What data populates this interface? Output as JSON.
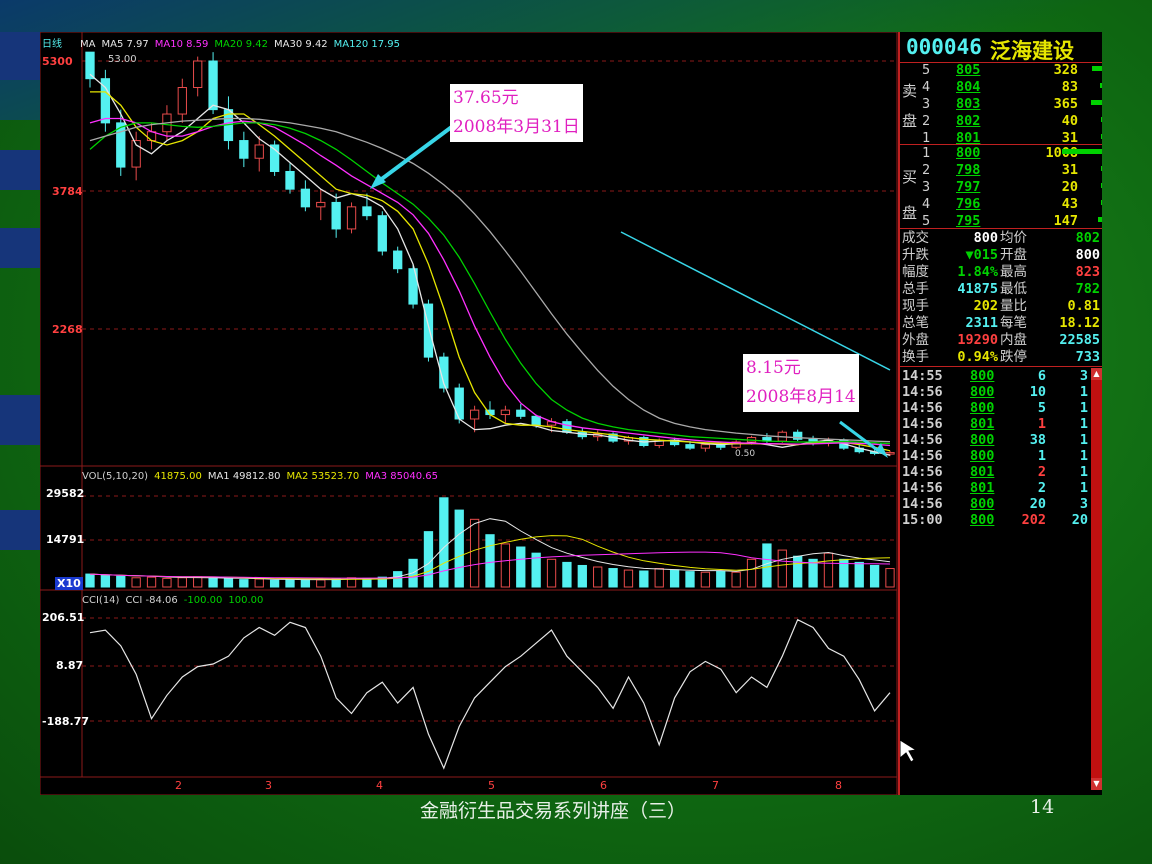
{
  "slide": {
    "title": "金融衍生品交易系列讲座（三）",
    "page_number": "14"
  },
  "colors": {
    "up": "#e84b4b",
    "down": "#54f0f0",
    "ma5": "#e6e6e6",
    "ma10": "#e6e600",
    "ma20": "#ff30ff",
    "ma30": "#00d200",
    "ma120": "#aaaaaa",
    "grid": "#8b1a1a",
    "axis": "#c02020",
    "arrow": "#38d6e8"
  },
  "chart_header": {
    "period": "日线",
    "items": [
      {
        "label": "MA",
        "color": "#e6e6e6"
      },
      {
        "label": "MA5 7.97",
        "color": "#e6e6e6"
      },
      {
        "label": "MA10 8.59",
        "color": "#ff30ff"
      },
      {
        "label": "MA20 9.42",
        "color": "#00d200"
      },
      {
        "label": "MA30 9.42",
        "color": "#e6e6e6"
      },
      {
        "label": "MA120 17.95",
        "color": "#54f0f0"
      }
    ]
  },
  "price_axis": {
    "ticks": [
      "5300",
      "3784",
      "2268"
    ],
    "high_label": "53.00",
    "low_label": "0.50"
  },
  "volume_header": {
    "items": [
      {
        "label": "VOL(5,10,20)",
        "color": "#d0d0d0"
      },
      {
        "label": "41875.00",
        "color": "#e6e600"
      },
      {
        "label": "MA1 49812.80",
        "color": "#e6e6e6"
      },
      {
        "label": "MA2 53523.70",
        "color": "#e6e600"
      },
      {
        "label": "MA3 85040.65",
        "color": "#ff30ff"
      }
    ],
    "ticks": [
      "29582",
      "14791"
    ],
    "unit": "X10"
  },
  "cci_header": {
    "items": [
      {
        "label": "CCI(14)",
        "color": "#d0d0d0"
      },
      {
        "label": "CCI -84.06",
        "color": "#d0d0d0"
      },
      {
        "label": "-100.00",
        "color": "#00d200"
      },
      {
        "label": "100.00",
        "color": "#00d200"
      }
    ],
    "ticks": [
      "206.51",
      "8.87",
      "-188.77"
    ]
  },
  "time_axis": [
    "2",
    "3",
    "4",
    "5",
    "6",
    "7",
    "8"
  ],
  "annotations": {
    "high": {
      "line1": "37.65元",
      "line2": "2008年3月31日"
    },
    "low": {
      "line1": "8.15元",
      "line2": "2008年8月14"
    }
  },
  "stock": {
    "code": "000046",
    "name": "泛海建设"
  },
  "order_book": {
    "sell_label": [
      "卖",
      "盘"
    ],
    "buy_label": [
      "买",
      "盘"
    ],
    "sell": [
      {
        "level": "5",
        "price": "805",
        "volume": "328",
        "bar": 0.25
      },
      {
        "level": "4",
        "price": "804",
        "volume": "83",
        "bar": 0.05
      },
      {
        "level": "3",
        "price": "803",
        "volume": "365",
        "bar": 0.28
      },
      {
        "level": "2",
        "price": "802",
        "volume": "40",
        "bar": 0.03
      },
      {
        "level": "1",
        "price": "801",
        "volume": "31",
        "bar": 0.02
      }
    ],
    "buy": [
      {
        "level": "1",
        "price": "800",
        "volume": "1008",
        "bar": 1.0
      },
      {
        "level": "2",
        "price": "798",
        "volume": "31",
        "bar": 0.02
      },
      {
        "level": "3",
        "price": "797",
        "volume": "20",
        "bar": 0.02
      },
      {
        "level": "4",
        "price": "796",
        "volume": "43",
        "bar": 0.03
      },
      {
        "level": "5",
        "price": "795",
        "volume": "147",
        "bar": 0.11
      }
    ]
  },
  "quote": {
    "rows": [
      {
        "l1": "成交",
        "v1": "800",
        "l2": "均价",
        "v2": "802",
        "c1": "#ffffff",
        "c2": "#00d200"
      },
      {
        "l1": "升跌",
        "v1": "▼015",
        "l2": "开盘",
        "v2": "800",
        "c1": "#00d200",
        "c2": "#ffffff"
      },
      {
        "l1": "幅度",
        "v1": "1.84%",
        "l2": "最高",
        "v2": "823",
        "c1": "#00d200",
        "c2": "#ff4040"
      },
      {
        "l1": "总手",
        "v1": "41875",
        "l2": "最低",
        "v2": "782",
        "c1": "#54f0f0",
        "c2": "#00d200"
      },
      {
        "l1": "现手",
        "v1": "202",
        "l2": "量比",
        "v2": "0.81",
        "c1": "#e6e600",
        "c2": "#e6e600"
      },
      {
        "l1": "总笔",
        "v1": "2311",
        "l2": "每笔",
        "v2": "18.12",
        "c1": "#54f0f0",
        "c2": "#e6e600"
      },
      {
        "l1": "外盘",
        "v1": "19290",
        "l2": "内盘",
        "v2": "22585",
        "c1": "#ff4040",
        "c2": "#54f0f0"
      },
      {
        "l1": "换手",
        "v1": "0.94%",
        "l2": "跌停",
        "v2": "733",
        "c1": "#e6e600",
        "c2": "#54f0f0"
      }
    ]
  },
  "ticks": [
    {
      "time": "14:55",
      "price": "800",
      "vol": "6",
      "n": "3",
      "vc": "#54f0f0"
    },
    {
      "time": "14:56",
      "price": "800",
      "vol": "10",
      "n": "1",
      "vc": "#54f0f0"
    },
    {
      "time": "14:56",
      "price": "800",
      "vol": "5",
      "n": "1",
      "vc": "#54f0f0"
    },
    {
      "time": "14:56",
      "price": "801",
      "vol": "1",
      "n": "1",
      "vc": "#ff4040"
    },
    {
      "time": "14:56",
      "price": "800",
      "vol": "38",
      "n": "1",
      "vc": "#54f0f0"
    },
    {
      "time": "14:56",
      "price": "800",
      "vol": "1",
      "n": "1",
      "vc": "#54f0f0"
    },
    {
      "time": "14:56",
      "price": "801",
      "vol": "2",
      "n": "1",
      "vc": "#ff4040"
    },
    {
      "time": "14:56",
      "price": "801",
      "vol": "2",
      "n": "1",
      "vc": "#54f0f0"
    },
    {
      "time": "14:56",
      "price": "800",
      "vol": "20",
      "n": "3",
      "vc": "#54f0f0"
    },
    {
      "time": "15:00",
      "price": "800",
      "vol": "202",
      "n": "20",
      "vc": "#ff4040"
    }
  ],
  "chart_data": {
    "type": "candlestick",
    "ma_series": {
      "ma5": [
        5150,
        5000,
        4700,
        4350,
        4250,
        4400,
        4500,
        4650,
        4800,
        4750,
        4600,
        4420,
        4300,
        4150,
        4000,
        3850,
        3750,
        3800,
        3750,
        3650,
        3400,
        3000,
        2300,
        1650,
        1250,
        1130,
        1140,
        1180,
        1200,
        1170,
        1120,
        1100,
        1080,
        1070,
        1040,
        1010,
        990,
        1000,
        1010,
        990,
        970,
        960,
        970,
        980,
        960,
        930,
        960,
        990,
        1010,
        970,
        920,
        880,
        840
      ],
      "ma10": [
        4950,
        4950,
        4800,
        4550,
        4400,
        4350,
        4400,
        4500,
        4650,
        4700,
        4700,
        4580,
        4450,
        4300,
        4150,
        4000,
        3850,
        3800,
        3780,
        3720,
        3600,
        3400,
        3000,
        2500,
        1950,
        1550,
        1300,
        1200,
        1180,
        1180,
        1160,
        1130,
        1110,
        1090,
        1070,
        1040,
        1020,
        1010,
        1000,
        990,
        980,
        975,
        970,
        970,
        970,
        965,
        960,
        975,
        990,
        985,
        960,
        930,
        890
      ],
      "ma20": [
        4600,
        4650,
        4650,
        4600,
        4500,
        4450,
        4450,
        4500,
        4560,
        4600,
        4620,
        4600,
        4550,
        4450,
        4350,
        4230,
        4120,
        4000,
        3900,
        3800,
        3700,
        3560,
        3350,
        3050,
        2700,
        2300,
        1950,
        1650,
        1430,
        1290,
        1220,
        1180,
        1150,
        1130,
        1110,
        1090,
        1070,
        1050,
        1030,
        1015,
        1000,
        990,
        980,
        975,
        970,
        968,
        966,
        968,
        975,
        980,
        975,
        965,
        950
      ],
      "ma30": [
        4300,
        4450,
        4550,
        4600,
        4600,
        4580,
        4560,
        4550,
        4560,
        4580,
        4600,
        4600,
        4580,
        4540,
        4480,
        4400,
        4300,
        4180,
        4050,
        3920,
        3800,
        3680,
        3520,
        3330,
        3080,
        2780,
        2460,
        2150,
        1880,
        1650,
        1470,
        1350,
        1260,
        1200,
        1160,
        1130,
        1110,
        1090,
        1070,
        1050,
        1040,
        1030,
        1020,
        1010,
        1000,
        995,
        990,
        990,
        992,
        995,
        990,
        982,
        972
      ],
      "ma120": [
        4400,
        4450,
        4500,
        4550,
        4580,
        4600,
        4620,
        4630,
        4640,
        4650,
        4650,
        4640,
        4620,
        4600,
        4570,
        4540,
        4500,
        4440,
        4380,
        4310,
        4230,
        4140,
        4030,
        3900,
        3750,
        3570,
        3370,
        3150,
        2920,
        2680,
        2440,
        2210,
        2000,
        1800,
        1620,
        1470,
        1350,
        1260,
        1200,
        1160,
        1130,
        1110,
        1090,
        1075,
        1060,
        1048,
        1038,
        1030,
        1022,
        1015,
        1008,
        1000,
        993
      ]
    },
    "candles_ohlc": [
      [
        5400,
        5500,
        5000,
        5100
      ],
      [
        5100,
        5200,
        4500,
        4600
      ],
      [
        4600,
        4750,
        4000,
        4100
      ],
      [
        4100,
        4500,
        3950,
        4400
      ],
      [
        4400,
        4600,
        4300,
        4500
      ],
      [
        4500,
        4800,
        4400,
        4700
      ],
      [
        4700,
        5100,
        4600,
        5000
      ],
      [
        5000,
        5350,
        4900,
        5300
      ],
      [
        5300,
        5400,
        4700,
        4750
      ],
      [
        4750,
        4900,
        4300,
        4400
      ],
      [
        4400,
        4500,
        4100,
        4200
      ],
      [
        4200,
        4450,
        4050,
        4350
      ],
      [
        4350,
        4400,
        4000,
        4050
      ],
      [
        4050,
        4150,
        3800,
        3850
      ],
      [
        3850,
        3950,
        3600,
        3650
      ],
      [
        3650,
        3850,
        3500,
        3700
      ],
      [
        3700,
        3800,
        3300,
        3400
      ],
      [
        3400,
        3700,
        3350,
        3650
      ],
      [
        3650,
        3800,
        3500,
        3550
      ],
      [
        3550,
        3600,
        3100,
        3150
      ],
      [
        3150,
        3200,
        2900,
        2950
      ],
      [
        2950,
        3000,
        2500,
        2550
      ],
      [
        2550,
        2600,
        1900,
        1950
      ],
      [
        1950,
        2000,
        1550,
        1600
      ],
      [
        1600,
        1650,
        1200,
        1250
      ],
      [
        1250,
        1400,
        1100,
        1350
      ],
      [
        1350,
        1450,
        1250,
        1300
      ],
      [
        1300,
        1400,
        1200,
        1350
      ],
      [
        1350,
        1420,
        1250,
        1280
      ],
      [
        1280,
        1300,
        1150,
        1180
      ],
      [
        1180,
        1260,
        1100,
        1220
      ],
      [
        1220,
        1250,
        1080,
        1100
      ],
      [
        1100,
        1150,
        1020,
        1050
      ],
      [
        1050,
        1120,
        1000,
        1080
      ],
      [
        1080,
        1100,
        980,
        1000
      ],
      [
        1000,
        1060,
        960,
        1040
      ],
      [
        1040,
        1060,
        930,
        950
      ],
      [
        950,
        1030,
        920,
        1010
      ],
      [
        1010,
        1040,
        940,
        960
      ],
      [
        960,
        1000,
        900,
        920
      ],
      [
        920,
        980,
        880,
        960
      ],
      [
        960,
        990,
        900,
        930
      ],
      [
        930,
        1010,
        910,
        990
      ],
      [
        990,
        1060,
        960,
        1040
      ],
      [
        1040,
        1090,
        980,
        1000
      ],
      [
        1000,
        1120,
        980,
        1100
      ],
      [
        1100,
        1130,
        1000,
        1020
      ],
      [
        1020,
        1060,
        950,
        980
      ],
      [
        980,
        1040,
        940,
        1010
      ],
      [
        1010,
        1030,
        900,
        920
      ],
      [
        920,
        960,
        860,
        880
      ],
      [
        880,
        920,
        840,
        860
      ],
      [
        860,
        890,
        830,
        870
      ]
    ],
    "volume": [
      420,
      380,
      350,
      300,
      320,
      280,
      300,
      330,
      280,
      260,
      240,
      260,
      220,
      250,
      240,
      230,
      260,
      300,
      280,
      320,
      500,
      900,
      1800,
      2900,
      2500,
      2200,
      1700,
      1400,
      1300,
      1100,
      900,
      800,
      700,
      650,
      600,
      550,
      520,
      600,
      560,
      500,
      480,
      520,
      480,
      900,
      1400,
      1200,
      1000,
      900,
      1100,
      900,
      800,
      700,
      600
    ],
    "cci": [
      150,
      160,
      100,
      -10,
      -180,
      -90,
      -20,
      20,
      30,
      60,
      130,
      170,
      140,
      190,
      170,
      60,
      -100,
      -160,
      -80,
      -40,
      -120,
      -60,
      -240,
      -370,
      -210,
      -100,
      -40,
      20,
      60,
      110,
      160,
      60,
      0,
      -60,
      -140,
      -20,
      -120,
      -280,
      -100,
      0,
      40,
      10,
      -80,
      -20,
      -60,
      60,
      200,
      170,
      90,
      60,
      -30,
      -150,
      -80
    ],
    "ranges": {
      "price_top_label": "5300",
      "price_mid_label": "3784",
      "price_low_label": "2268"
    }
  }
}
